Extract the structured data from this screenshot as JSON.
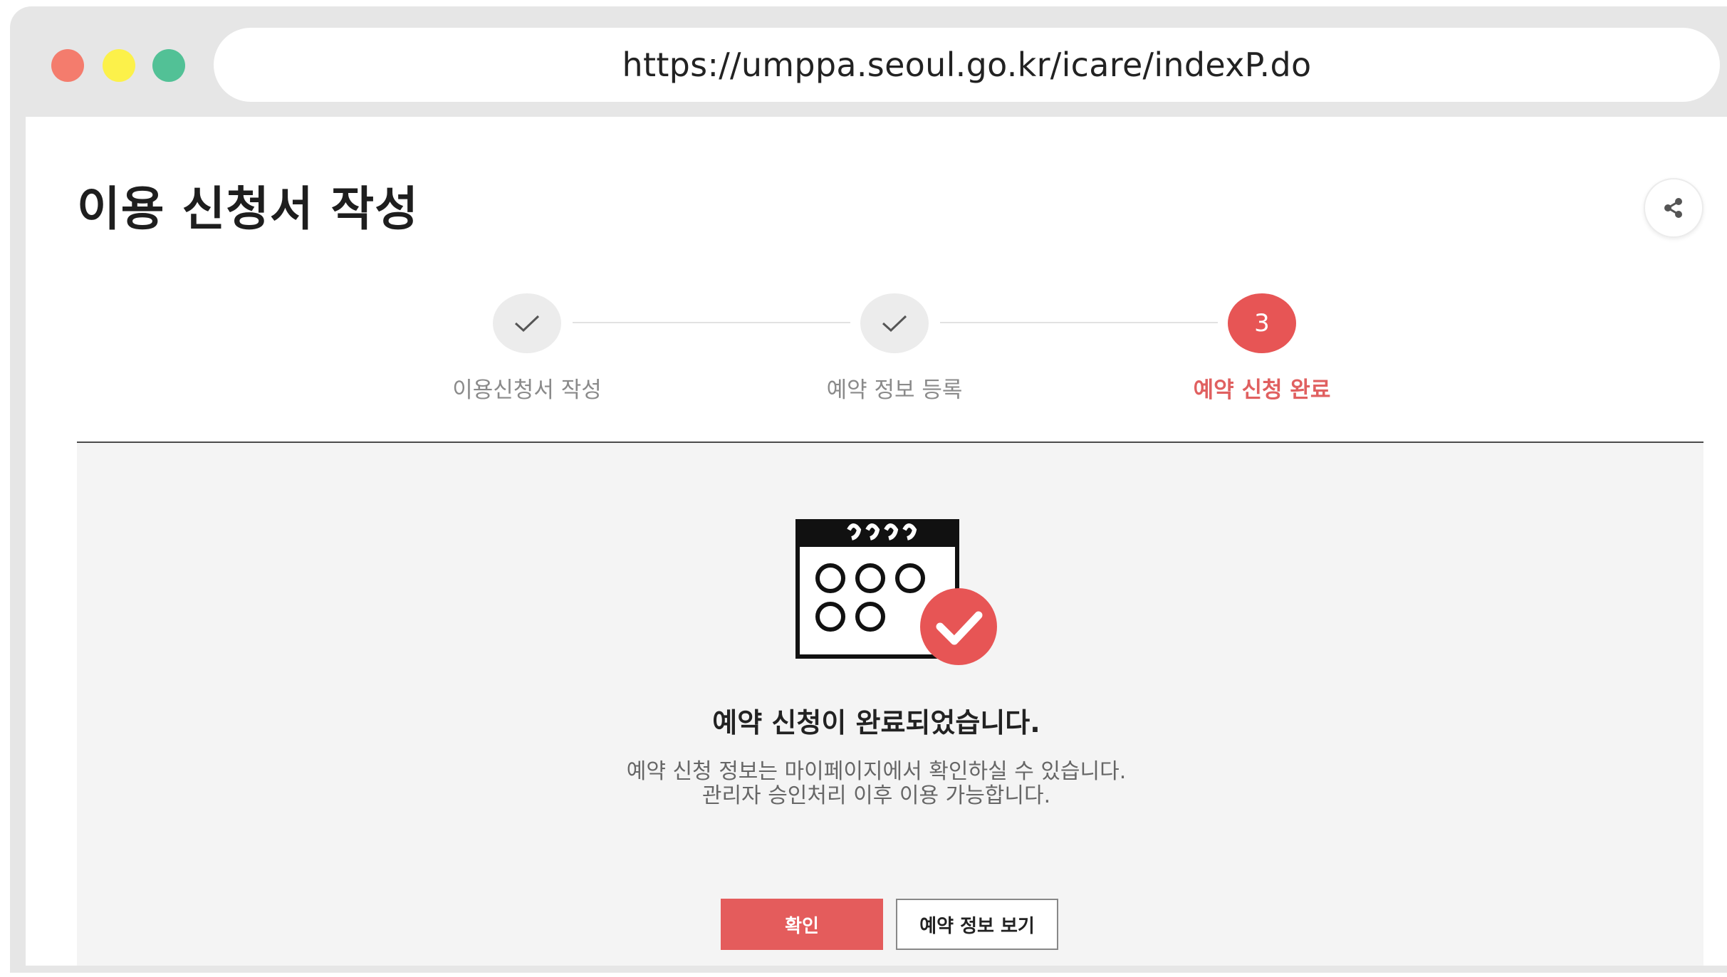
{
  "browser": {
    "url": "https://umppa.seoul.go.kr/icare/indexP.do"
  },
  "page": {
    "title": "이용 신청서 작성",
    "share_icon": "share-icon"
  },
  "steps": [
    {
      "label": "이용신청서 작성",
      "state": "done"
    },
    {
      "label": "예약 정보 등록",
      "state": "done"
    },
    {
      "label": "예약 신청 완료",
      "state": "active",
      "number": "3"
    }
  ],
  "result": {
    "title": "예약 신청이 완료되었습니다.",
    "line1": "예약 신청 정보는 마이페이지에서 확인하실 수 있습니다.",
    "line2": "관리자 승인처리 이후 이용 가능합니다."
  },
  "buttons": {
    "confirm": "확인",
    "view_info": "예약 정보 보기"
  },
  "colors": {
    "accent": "#e45c5c",
    "dot_red": "#f47c6d",
    "dot_yellow": "#fcf14a",
    "dot_green": "#52c196"
  }
}
